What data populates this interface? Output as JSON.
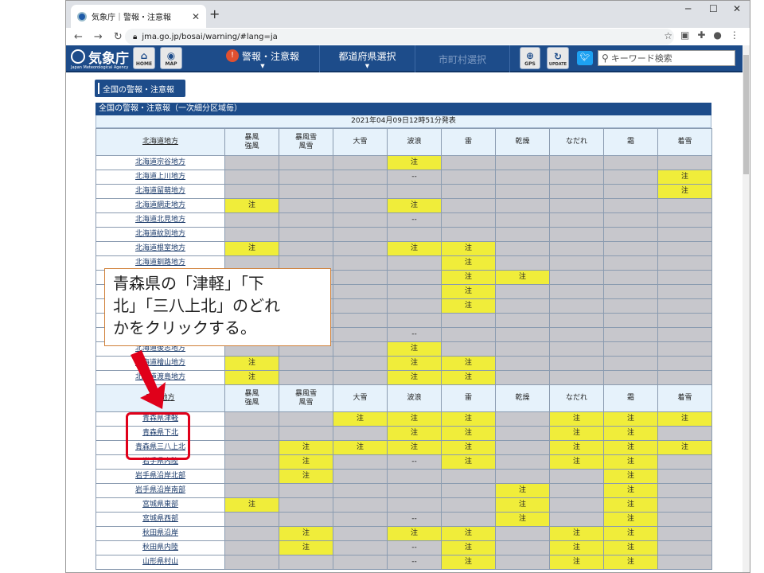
{
  "browser": {
    "tab_title": "気象庁｜警報・注意報",
    "url": "jma.go.jp/bosai/warning/#lang=ja",
    "icons": [
      "back-icon",
      "forward-icon",
      "reload-icon",
      "lock-icon",
      "star-icon",
      "extensions-icon",
      "profile-icon",
      "menu-icon"
    ]
  },
  "site": {
    "logo_name": "気象庁",
    "logo_sub": "Japan Meteorological Agency",
    "home_label": "HOME",
    "map_label": "MAP",
    "menu_warning": "警報・注意報",
    "menu_pref": "都道府県選択",
    "menu_city": "市町村選択",
    "gps_label": "GPS",
    "update_label": "UPDATE",
    "search_placeholder": "キーワード検索",
    "accent_color": "#1d4c8a",
    "warn_color": "#f0ed3a"
  },
  "page": {
    "section_button": "全国の警報・注意報",
    "table_title": "全国の警報・注意報（一次細分区域毎）",
    "issued": "2021年04月09日12時51分発表"
  },
  "columns": [
    "暴風\n強風",
    "暴風雪\n風雪",
    "大雪",
    "波浪",
    "雷",
    "乾燥",
    "なだれ",
    "霜",
    "着雪"
  ],
  "groups": [
    {
      "region": "北海道地方",
      "rows": [
        {
          "name": "北海道宗谷地方",
          "cells": [
            "",
            "",
            "",
            "注",
            "",
            "",
            "",
            "",
            ""
          ]
        },
        {
          "name": "北海道上川地方",
          "cells": [
            "",
            "",
            "",
            "--",
            "",
            "",
            "",
            "",
            "注"
          ]
        },
        {
          "name": "北海道留萌地方",
          "cells": [
            "",
            "",
            "",
            "",
            "",
            "",
            "",
            "",
            "注"
          ]
        },
        {
          "name": "北海道網走地方",
          "cells": [
            "注",
            "",
            "",
            "注",
            "",
            "",
            "",
            "",
            ""
          ]
        },
        {
          "name": "北海道北見地方",
          "cells": [
            "",
            "",
            "",
            "--",
            "",
            "",
            "",
            "",
            ""
          ]
        },
        {
          "name": "北海道紋別地方",
          "cells": [
            "",
            "",
            "",
            "",
            "",
            "",
            "",
            "",
            ""
          ]
        },
        {
          "name": "北海道根室地方",
          "cells": [
            "注",
            "",
            "",
            "注",
            "注",
            "",
            "",
            "",
            ""
          ]
        },
        {
          "name": "北海道釧路地方",
          "cells": [
            "",
            "",
            "",
            "",
            "注",
            "",
            "",
            "",
            ""
          ]
        },
        {
          "name": "",
          "cells": [
            "",
            "",
            "",
            "",
            "注",
            "注",
            "",
            "",
            ""
          ]
        },
        {
          "name": "",
          "cells": [
            "",
            "",
            "",
            "",
            "注",
            "",
            "",
            "",
            ""
          ]
        },
        {
          "name": "",
          "cells": [
            "",
            "",
            "",
            "",
            "注",
            "",
            "",
            "",
            ""
          ]
        },
        {
          "name": "",
          "cells": [
            "",
            "",
            "",
            "",
            "",
            "",
            "",
            "",
            ""
          ]
        },
        {
          "name": "",
          "cells": [
            "",
            "",
            "",
            "--",
            "",
            "",
            "",
            "",
            ""
          ]
        },
        {
          "name": "北海道後志地方",
          "cells": [
            "",
            "",
            "",
            "注",
            "",
            "",
            "",
            "",
            ""
          ]
        },
        {
          "name": "北海道檜山地方",
          "cells": [
            "注",
            "",
            "",
            "注",
            "注",
            "",
            "",
            "",
            ""
          ]
        },
        {
          "name": "北海道渡島地方",
          "cells": [
            "注",
            "",
            "",
            "注",
            "注",
            "",
            "",
            "",
            ""
          ]
        }
      ]
    },
    {
      "region": "東北地方",
      "rows": [
        {
          "name": "青森県津軽",
          "cells": [
            "",
            "",
            "注",
            "注",
            "注",
            "",
            "注",
            "注",
            "注"
          ]
        },
        {
          "name": "青森県下北",
          "cells": [
            "",
            "",
            "",
            "注",
            "注",
            "",
            "注",
            "注",
            ""
          ]
        },
        {
          "name": "青森県三八上北",
          "cells": [
            "",
            "注",
            "注",
            "注",
            "注",
            "",
            "注",
            "注",
            "注"
          ]
        },
        {
          "name": "岩手県内陸",
          "cells": [
            "",
            "注",
            "",
            "--",
            "注",
            "",
            "注",
            "注",
            ""
          ]
        },
        {
          "name": "岩手県沿岸北部",
          "cells": [
            "",
            "注",
            "",
            "",
            "",
            "",
            "",
            "注",
            ""
          ]
        },
        {
          "name": "岩手県沿岸南部",
          "cells": [
            "",
            "",
            "",
            "",
            "",
            "注",
            "",
            "注",
            ""
          ]
        },
        {
          "name": "宮城県東部",
          "cells": [
            "注",
            "",
            "",
            "",
            "",
            "注",
            "",
            "注",
            ""
          ]
        },
        {
          "name": "宮城県西部",
          "cells": [
            "",
            "",
            "",
            "--",
            "",
            "注",
            "",
            "注",
            ""
          ]
        },
        {
          "name": "秋田県沿岸",
          "cells": [
            "",
            "注",
            "",
            "注",
            "注",
            "",
            "注",
            "注",
            ""
          ]
        },
        {
          "name": "秋田県内陸",
          "cells": [
            "",
            "注",
            "",
            "--",
            "注",
            "",
            "注",
            "注",
            ""
          ]
        },
        {
          "name": "山形県村山",
          "cells": [
            "",
            "",
            "",
            "--",
            "注",
            "",
            "注",
            "注",
            ""
          ]
        }
      ]
    }
  ],
  "annotation": {
    "callout_text": "青森県の「津軽」「下北」「三八上北」のどれかをクリックする。",
    "callout_line1": "青森県の「津軽」「下",
    "callout_line2": "北」「三八上北」のどれ",
    "callout_line3": "かをクリックする。",
    "arrow_color": "#e0001a"
  }
}
